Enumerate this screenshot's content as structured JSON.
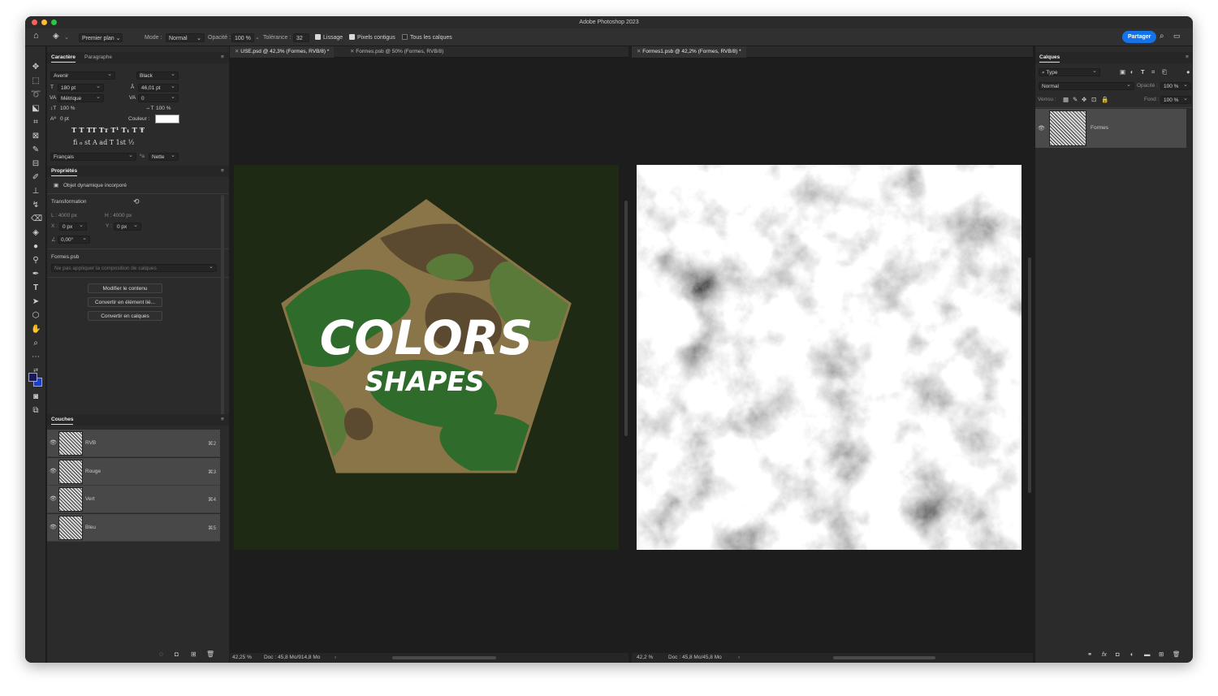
{
  "app": {
    "title": "Adobe Photoshop 2023",
    "share_label": "Partager"
  },
  "options_bar": {
    "tool_preset": "Premier plan",
    "mode_label": "Mode :",
    "mode_value": "Normal",
    "opacity_label": "Opacité :",
    "opacity_value": "100 %",
    "tolerance_label": "Tolérance :",
    "tolerance_value": "32",
    "smoothing_label": "Lissage",
    "contiguous_label": "Pixels contigus",
    "all_layers_label": "Tous les calques"
  },
  "character_panel": {
    "tab_character": "Caractère",
    "tab_paragraph": "Paragraphe",
    "font_family": "Avenir",
    "font_style": "Black",
    "font_size": "180 pt",
    "leading": "46,01 pt",
    "kerning": "Métrique",
    "tracking": "0",
    "vertical_scale": "100 %",
    "horizontal_scale": "100 %",
    "baseline_shift": "0 pt",
    "color_label": "Couleur :",
    "style_row_1": "T  T  TT  Tт  T¹  T₁  T  Ŧ",
    "style_row_2": "fi  ℴ  st  A  ad  T  1st  ½",
    "language": "Français",
    "aa_label": "ªa",
    "antialias": "Nette"
  },
  "properties_panel": {
    "title": "Propriétés",
    "object_type": "Objet dynamique incorporé",
    "transform_label": "Transformation",
    "width": "L : 4000 px",
    "height": "H : 4000 px",
    "x_label": "X :",
    "x_value": "0 px",
    "y_label": "Y :",
    "y_value": "0 px",
    "angle": "0,00°",
    "linked_file": "Formes.psb",
    "comp_placeholder": "Ne pas appliquer la composition de calques",
    "btn_edit": "Modifier le contenu",
    "btn_convert_linked": "Convertir en élément lié...",
    "btn_convert_layers": "Convertir en calques"
  },
  "channels_panel": {
    "title": "Couches",
    "channels": [
      {
        "name": "RVB",
        "shortcut": "⌘2"
      },
      {
        "name": "Rouge",
        "shortcut": "⌘3"
      },
      {
        "name": "Vert",
        "shortcut": "⌘4"
      },
      {
        "name": "Bleu",
        "shortcut": "⌘5"
      }
    ]
  },
  "documents": {
    "left": {
      "tab_1": "USE.psd @ 42,3% (Formes, RVB/8) *",
      "tab_2": "Formes.psb @ 50% (Formes, RVB/8)",
      "zoom": "42,25 %",
      "doc_info": "Doc : 45,8 Mo/914,8 Mo",
      "art_title": "COLORS",
      "art_subtitle": "SHAPES"
    },
    "right": {
      "tab_1": "Formes1.psb @ 42,2% (Formes, RVB/8) *",
      "zoom": "42,2 %",
      "doc_info": "Doc : 45,8 Mo/45,8 Mo"
    }
  },
  "layers_panel": {
    "title": "Calques",
    "filter_label": "Type",
    "blend_mode": "Normal",
    "opacity_label": "Opacité :",
    "opacity_value": "100 %",
    "lock_label": "Verrou :",
    "fill_label": "Fond :",
    "fill_value": "100 %",
    "layers": [
      {
        "name": "Formes"
      }
    ]
  },
  "colors": {
    "foreground": "#1a1a5a",
    "background": "#1f3fbf",
    "camo_dark": "#5b4a30",
    "camo_tan": "#8a7549",
    "camo_green": "#2f6b2a",
    "camo_olive": "#5a7a3a",
    "canvas_left": "#1e2a14"
  }
}
